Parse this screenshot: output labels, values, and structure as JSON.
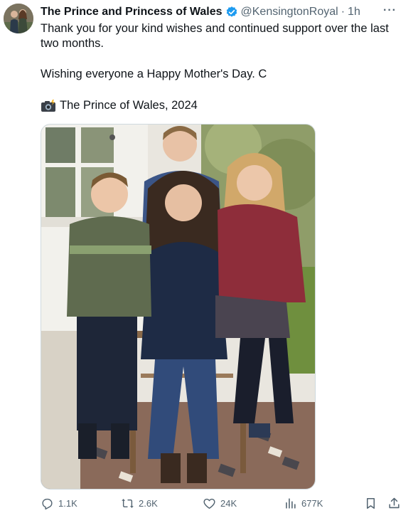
{
  "tweet": {
    "author_name": "The Prince and Princess of Wales",
    "handle": "@KensingtonRoyal",
    "separator": "·",
    "time": "1h",
    "more_label": "···",
    "paragraphs": [
      "Thank you for your kind wishes and continued support over the last two months.",
      "Wishing everyone a Happy Mother's Day. C",
      "The Prince of Wales, 2024"
    ],
    "camera_icon": "camera-flash-icon",
    "verified_icon": "verified-badge-icon",
    "verified_color": "#1d9bf0"
  },
  "actions": {
    "replies": "1.1K",
    "reposts": "2.6K",
    "likes": "24K",
    "views": "677K"
  },
  "colors": {
    "text": "#0f1419",
    "secondary": "#536471",
    "border": "#cfd9de"
  }
}
